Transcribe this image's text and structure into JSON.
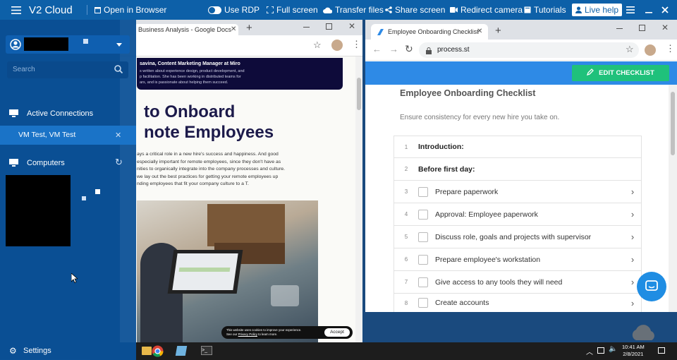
{
  "topbar": {
    "brand": "V2 Cloud",
    "open_browser": "Open in Browser",
    "use_rdp": "Use RDP",
    "full_screen": "Full screen",
    "transfer_files": "Transfer files",
    "share_screen": "Share screen",
    "redirect_camera": "Redirect camera",
    "tutorials": "Tutorials",
    "live_help": "Live help"
  },
  "sidebar": {
    "search_placeholder": "Search",
    "active_connections": "Active Connections",
    "active_item": "VM Test, VM Test",
    "computers": "Computers",
    "settings": "Settings"
  },
  "left_window": {
    "tab_title": "Business Analysis - Google Docs",
    "banner_line1": "savina, Content Marketing Manager at Miro",
    "banner_line2": "s written about experience design, product development, and",
    "banner_line3": "p facilitation. She has been working in distributed teams for",
    "banner_line4": "ars, and is passionate about helping them succeed.",
    "heading_line1": "to Onboard",
    "heading_line2": "note Employees",
    "para": [
      "ays a critical role in a new hire's success and happiness. And good",
      "especially important for remote employees, since they don't have as",
      "nities to organically integrate into the company processes and culture.",
      "we lay out the best practices for getting your remote employees up",
      "nding employees that fit your company culture to a T."
    ],
    "cookie_line1": "This website uses cookies to improve your experience.",
    "cookie_line2_pre": "See our ",
    "cookie_link": "Privacy Policy",
    "cookie_line2_post": " to learn more.",
    "accept": "Accept"
  },
  "right_window": {
    "tab_title": "Employee Onboarding Checklist",
    "url": "process.st",
    "edit_button": "EDIT CHECKLIST",
    "checklist_title": "Employee Onboarding Checklist",
    "checklist_subtitle": "Ensure consistency for every new hire you take on.",
    "rows": [
      {
        "num": "1",
        "label": "Introduction:"
      },
      {
        "num": "2",
        "label": "Before first day:"
      },
      {
        "num": "3",
        "label": "Prepare paperwork"
      },
      {
        "num": "4",
        "label": "Approval: Employee paperwork"
      },
      {
        "num": "5",
        "label": "Discuss role, goals and projects with supervisor"
      },
      {
        "num": "6",
        "label": "Prepare employee's workstation"
      },
      {
        "num": "7",
        "label": "Give access to any tools they will need"
      },
      {
        "num": "8",
        "label": "Create accounts"
      }
    ]
  },
  "taskbar": {
    "time": "10:41 AM",
    "date": "2/8/2021"
  },
  "colors": {
    "topbar": "#0d60a8",
    "sidebar": "#0a5096",
    "active_item": "#1a73c7",
    "process_blue": "#2e8ae6",
    "edit_green": "#1fc17b",
    "heading_navy": "#1c1a4a"
  }
}
